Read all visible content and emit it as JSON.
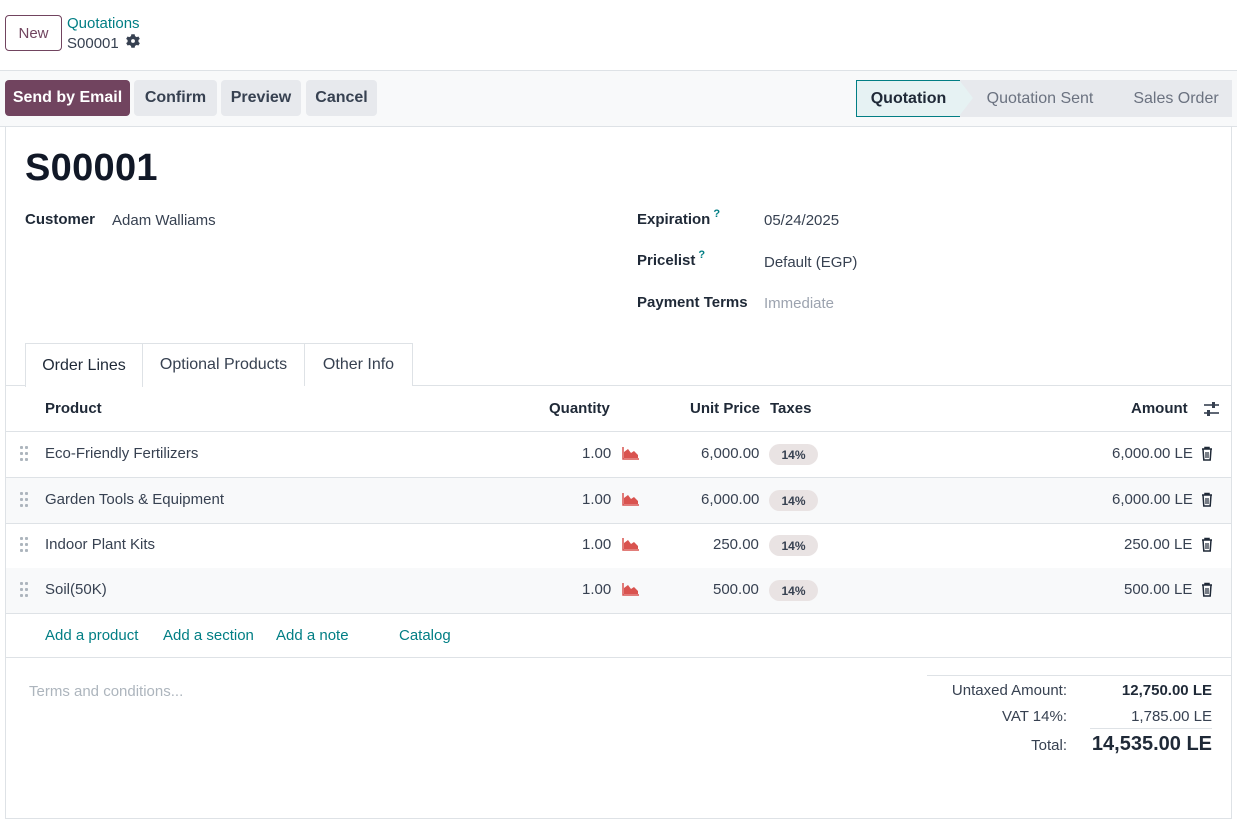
{
  "breadcrumb": {
    "new_label": "New",
    "parent": "Quotations",
    "current": "S00001"
  },
  "actions": {
    "send_email": "Send by Email",
    "confirm": "Confirm",
    "preview": "Preview",
    "cancel": "Cancel"
  },
  "statusbar": {
    "stages": [
      "Quotation",
      "Quotation Sent",
      "Sales Order"
    ],
    "active": "Quotation"
  },
  "form": {
    "name": "S00001",
    "customer_label": "Customer",
    "customer_value": "Adam Walliams",
    "expiration_label": "Expiration",
    "expiration_value": "05/24/2025",
    "pricelist_label": "Pricelist",
    "pricelist_value": "Default (EGP)",
    "payment_terms_label": "Payment Terms",
    "payment_terms_placeholder": "Immediate",
    "help_mark": "?"
  },
  "tabs": [
    "Order Lines",
    "Optional Products",
    "Other Info"
  ],
  "table": {
    "headers": {
      "product": "Product",
      "quantity": "Quantity",
      "unit_price": "Unit Price",
      "taxes": "Taxes",
      "amount": "Amount"
    },
    "rows": [
      {
        "product": "Eco-Friendly Fertilizers",
        "quantity": "1.00",
        "unit_price": "6,000.00",
        "tax": "14%",
        "amount": "6,000.00 LE"
      },
      {
        "product": "Garden Tools & Equipment",
        "quantity": "1.00",
        "unit_price": "6,000.00",
        "tax": "14%",
        "amount": "6,000.00 LE"
      },
      {
        "product": "Indoor Plant Kits",
        "quantity": "1.00",
        "unit_price": "250.00",
        "tax": "14%",
        "amount": "250.00 LE"
      },
      {
        "product": "Soil(50K)",
        "quantity": "1.00",
        "unit_price": "500.00",
        "tax": "14%",
        "amount": "500.00 LE"
      }
    ],
    "add_links": {
      "add_product": "Add a product",
      "add_section": "Add a section",
      "add_note": "Add a note",
      "catalog": "Catalog"
    }
  },
  "footer": {
    "terms_placeholder": "Terms and conditions...",
    "untaxed_label": "Untaxed Amount:",
    "untaxed_value": "12,750.00 LE",
    "vat_label": "VAT 14%:",
    "vat_value": "1,785.00 LE",
    "total_label": "Total:",
    "total_value": "14,535.00 LE"
  },
  "icons": {
    "settings": "gear-icon",
    "forecast": "area-chart-icon",
    "delete": "trash-icon",
    "column_options": "sliders-icon",
    "drag": "drag-handle-icon"
  },
  "colors": {
    "primary": "#71445f",
    "link": "#017e84",
    "forecast_icon": "#d9534f"
  }
}
